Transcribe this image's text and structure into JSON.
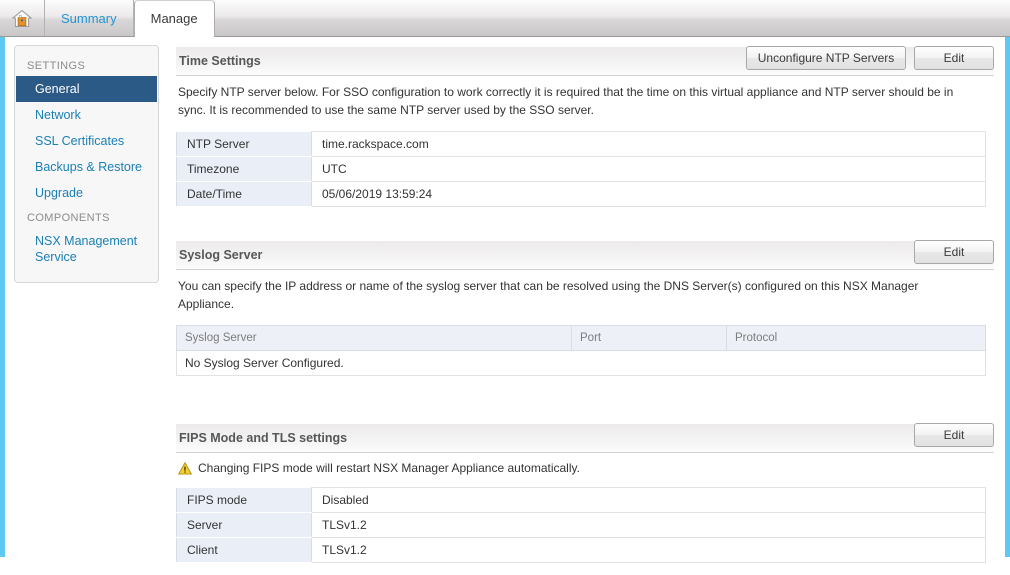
{
  "topbar": {
    "home_icon": "home-icon",
    "tabs": [
      {
        "label": "Summary",
        "active": false
      },
      {
        "label": "Manage",
        "active": true
      }
    ]
  },
  "sidebar": {
    "groups": [
      {
        "title": "SETTINGS",
        "items": [
          {
            "label": "General",
            "selected": true
          },
          {
            "label": "Network",
            "selected": false
          },
          {
            "label": "SSL Certificates",
            "selected": false
          },
          {
            "label": "Backups & Restore",
            "selected": false
          },
          {
            "label": "Upgrade",
            "selected": false
          }
        ]
      },
      {
        "title": "COMPONENTS",
        "items": [
          {
            "label": "NSX Management Service",
            "selected": false
          }
        ]
      }
    ]
  },
  "sections": {
    "time": {
      "title": "Time Settings",
      "unconfigure_button": "Unconfigure NTP Servers",
      "edit_button": "Edit",
      "description": "Specify NTP server below. For SSO configuration to work correctly it is required that the time on this virtual appliance and NTP server should be in sync. It is recommended to use the same NTP server used by the SSO server.",
      "rows": [
        {
          "key": "NTP Server",
          "value": "time.rackspace.com"
        },
        {
          "key": "Timezone",
          "value": "UTC"
        },
        {
          "key": "Date/Time",
          "value": "05/06/2019 13:59:24"
        }
      ]
    },
    "syslog": {
      "title": "Syslog Server",
      "edit_button": "Edit",
      "description": "You can specify the IP address or name of the syslog server that can be resolved using the DNS Server(s) configured on this NSX Manager Appliance.",
      "columns": [
        "Syslog Server",
        "Port",
        "Protocol"
      ],
      "empty_message": "No Syslog Server Configured."
    },
    "fips": {
      "title": "FIPS Mode and TLS settings",
      "edit_button": "Edit",
      "warning_icon": "warning-triangle-icon",
      "warning_text": "Changing FIPS mode will restart NSX Manager Appliance automatically.",
      "rows": [
        {
          "key": "FIPS mode",
          "value": "Disabled"
        },
        {
          "key": "Server",
          "value": "TLSv1.2"
        },
        {
          "key": "Client",
          "value": "TLSv1.2"
        }
      ]
    }
  },
  "colors": {
    "accent_blue": "#1a7fb5",
    "selected_nav": "#2b5a86",
    "edge_strip": "#5ec8f2",
    "warning": "#f2c41d"
  }
}
